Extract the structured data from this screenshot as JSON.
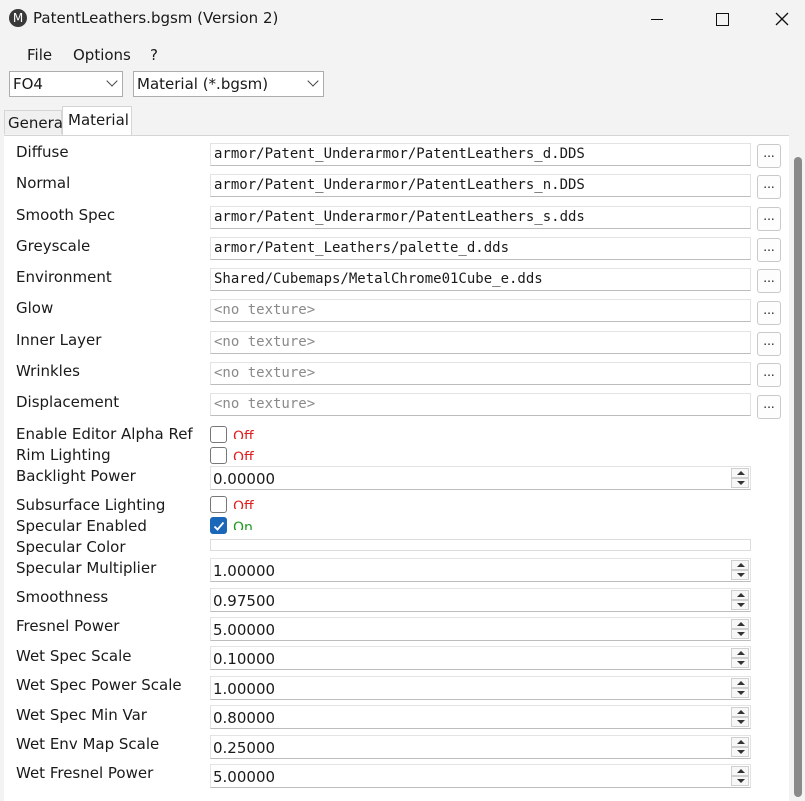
{
  "window": {
    "app_icon_letter": "M",
    "title": "PatentLeathers.bgsm (Version 2)"
  },
  "menu": [
    "File",
    "Options",
    "?"
  ],
  "toolbar": {
    "game": "FO4",
    "file_type": "Material (*.bgsm)"
  },
  "tabs": {
    "general": "General",
    "material": "Material"
  },
  "textures": [
    {
      "label": "Diffuse",
      "value": "armor/Patent_Underarmor/PatentLeathers_d.DDS",
      "empty": false
    },
    {
      "label": "Normal",
      "value": "armor/Patent_Underarmor/PatentLeathers_n.DDS",
      "empty": false
    },
    {
      "label": "Smooth Spec",
      "value": "armor/Patent_Underarmor/PatentLeathers_s.dds",
      "empty": false
    },
    {
      "label": "Greyscale",
      "value": "armor/Patent_Leathers/palette_d.dds",
      "empty": false
    },
    {
      "label": "Environment",
      "value": "Shared/Cubemaps/MetalChrome01Cube_e.dds",
      "empty": false
    },
    {
      "label": "Glow",
      "value": "<no texture>",
      "empty": true
    },
    {
      "label": "Inner Layer",
      "value": "<no texture>",
      "empty": true
    },
    {
      "label": "Wrinkles",
      "value": "<no texture>",
      "empty": true
    },
    {
      "label": "Displacement",
      "value": "<no texture>",
      "empty": true
    }
  ],
  "browse_label": "...",
  "checkboxes": {
    "enable_editor_alpha_ref": {
      "label": "Enable Editor Alpha Ref",
      "state": "Off"
    },
    "rim_lighting": {
      "label": "Rim Lighting",
      "state": "Off"
    },
    "subsurface_lighting": {
      "label": "Subsurface Lighting",
      "state": "Off"
    },
    "specular_enabled": {
      "label": "Specular Enabled",
      "state": "On"
    }
  },
  "specular_color": {
    "label": "Specular Color",
    "color": "#ffffff"
  },
  "numerics": {
    "backlight_power": {
      "label": "Backlight Power",
      "value": "0.00000"
    },
    "specular_multiplier": {
      "label": "Specular Multiplier",
      "value": "1.00000"
    },
    "smoothness": {
      "label": "Smoothness",
      "value": "0.97500"
    },
    "fresnel_power": {
      "label": "Fresnel Power",
      "value": "5.00000"
    },
    "wet_spec_scale": {
      "label": "Wet Spec Scale",
      "value": "0.10000"
    },
    "wet_spec_power_scale": {
      "label": "Wet Spec Power Scale",
      "value": "1.00000"
    },
    "wet_spec_min_var": {
      "label": "Wet Spec Min Var",
      "value": "0.80000"
    },
    "wet_env_map_scale": {
      "label": "Wet Env Map Scale",
      "value": "0.25000"
    },
    "wet_fresnel_power": {
      "label": "Wet Fresnel Power",
      "value": "5.00000"
    }
  },
  "colors": {
    "off": "#e02020",
    "on": "#1e9a1e",
    "accent": "#1a66b8"
  }
}
